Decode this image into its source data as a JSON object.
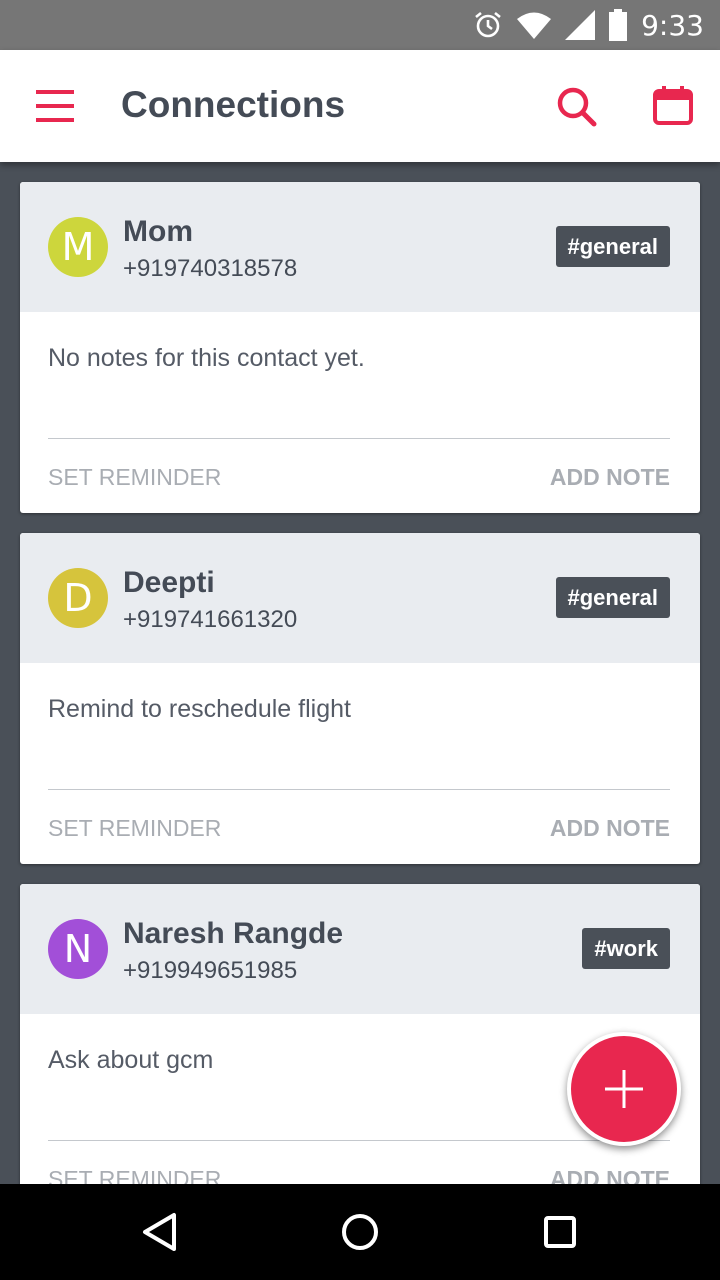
{
  "status_bar": {
    "time": "9:33"
  },
  "app_bar": {
    "title": "Connections"
  },
  "contacts": [
    {
      "initial": "M",
      "name": "Mom",
      "phone": "+919740318578",
      "tag": "#general",
      "note": "No notes for this contact yet.",
      "avatar_color": "#cdd63c"
    },
    {
      "initial": "D",
      "name": "Deepti",
      "phone": "+919741661320",
      "tag": "#general",
      "note": "Remind to reschedule flight",
      "avatar_color": "#d6c43c"
    },
    {
      "initial": "N",
      "name": "Naresh Rangde",
      "phone": "+919949651985",
      "tag": "#work",
      "note": "Ask about gcm",
      "avatar_color": "#a24fd8"
    }
  ],
  "actions": {
    "set_reminder": "SET REMINDER",
    "add_note": "ADD NOTE"
  },
  "colors": {
    "accent": "#e8274f",
    "header_text": "#444b56",
    "tag_bg": "#4a5058",
    "card_head_bg": "#e9ecf0"
  },
  "icons": {
    "menu": "hamburger-icon",
    "search": "search-icon",
    "calendar": "calendar-icon",
    "fab": "plus-icon",
    "nav_back": "back-triangle-icon",
    "nav_home": "home-circle-icon",
    "nav_recents": "recents-square-icon"
  }
}
